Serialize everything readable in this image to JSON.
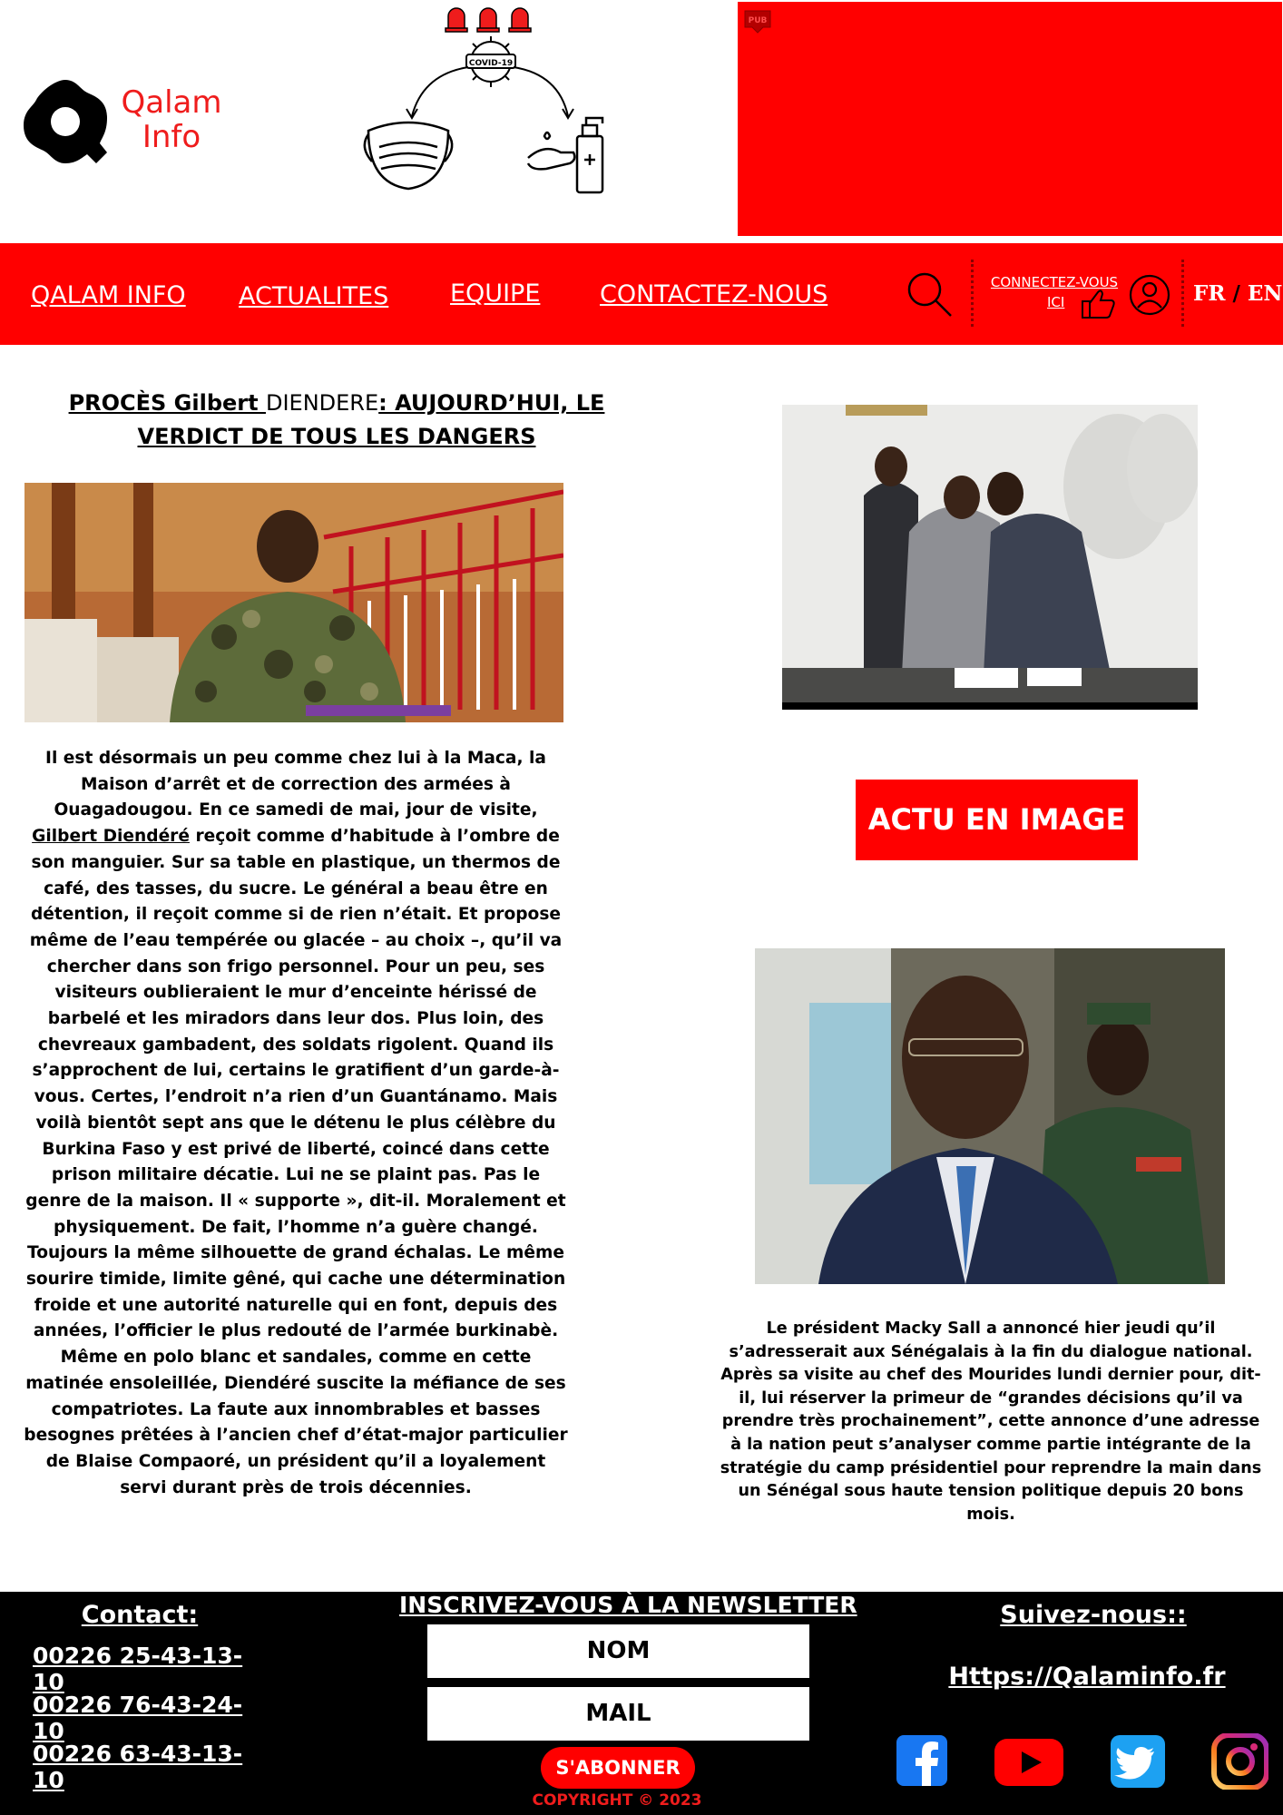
{
  "header": {
    "logo_text_line1": "Qalam",
    "logo_text_line2": "Info",
    "covid_label": "COVID-19",
    "ad_badge": "PUB"
  },
  "nav": {
    "items": [
      {
        "label": "QALAM INFO"
      },
      {
        "label": "ACTUALITES"
      },
      {
        "label": "EQUIPE"
      },
      {
        "label": "CONTACTEZ-NOUS"
      }
    ],
    "connect_line1": "CONNECTEZ-VOUS",
    "connect_line2": "ICI",
    "lang_fr": "FR",
    "lang_sep": "/",
    "lang_en": "EN"
  },
  "article": {
    "title_part1": "PROCÈS Gilbert ",
    "title_part2": "DIENDERE",
    "title_part3": ": AUJOURD’HUI, LE VERDICT DE TOUS LES DANGERS",
    "body_before_link": "Il est désormais un peu comme chez lui à la Maca, la Maison d’arrêt et de correction des armées à Ouagadougou. En ce samedi de mai, jour de visite, ",
    "body_link": "Gilbert Diendéré",
    "body_after_link": " reçoit comme d’habitude à l’ombre de son manguier. Sur sa table en plastique, un thermos de café, des tasses, du sucre. Le général a beau être en détention, il reçoit comme si de rien n’était. Et propose même de l’eau tempérée ou glacée – au choix –, qu’il va chercher dans son frigo personnel. Pour un peu, ses visiteurs oublieraient le mur d’enceinte hérissé de barbelé et les miradors dans leur dos. Plus loin, des chevreaux gambadent, des soldats rigolent. Quand ils s’approchent de lui, certains le gratifient d’un garde-à-vous. Certes, l’endroit n’a rien d’un Guantánamo. Mais voilà bientôt sept ans que le détenu le plus célèbre du Burkina Faso y est privé de liberté, coincé dans cette prison militaire décatie. Lui ne se plaint pas. Pas le genre de la maison. Il « supporte », dit-il. Moralement et physiquement. De fait, l’homme n’a guère changé. Toujours la même silhouette de grand échalas. Le même sourire timide, limite gêné, qui cache une détermination froide et une autorité naturelle qui en font, depuis des années, l’officier le plus redouté de l’armée burkinabè. Même en polo blanc et sandales, comme en cette matinée ensoleillée, Diendéré suscite la méfiance de ses compatriotes. La faute aux innombrables et basses besognes prêtées à l’ancien chef d’état-major particulier de Blaise Compaoré, un président qu’il a loyalement servi durant près de trois décennies."
  },
  "sidebar": {
    "actu_button": "ACTU EN IMAGE",
    "caption": "Le président Macky Sall a annoncé hier jeudi qu’il s’adresserait aux Sénégalais à la fin du dialogue national. Après sa visite au chef des Mourides lundi dernier pour, dit-il, lui réserver la primeur de “grandes décisions qu’il va prendre très prochainement”, cette annonce d’une adresse à la nation peut s’analyser comme partie intégrante de la stratégie du camp présidentiel pour reprendre la main dans un Sénégal sous haute tension politique depuis 20 bons mois."
  },
  "footer": {
    "contact_title": "Contact:",
    "phones": [
      "00226 25-43-13-10",
      "00226 76-43-24-10",
      "00226 63-43-13-10"
    ],
    "newsletter_title": "INSCRIVEZ-VOUS À LA NEWSLETTER",
    "name_placeholder": "NOM",
    "mail_placeholder": "MAIL",
    "subscribe_label": "S'ABONNER",
    "copyright": "COPYRIGHT © 2023",
    "follow_title": "Suivez-nous::",
    "site_url": "Https://Qalaminfo.fr",
    "socials": [
      "facebook",
      "youtube",
      "twitter",
      "instagram"
    ]
  },
  "colors": {
    "brand_red": "#ff0000",
    "logo_red": "#ef1c1c",
    "footer_bg": "#000000"
  }
}
